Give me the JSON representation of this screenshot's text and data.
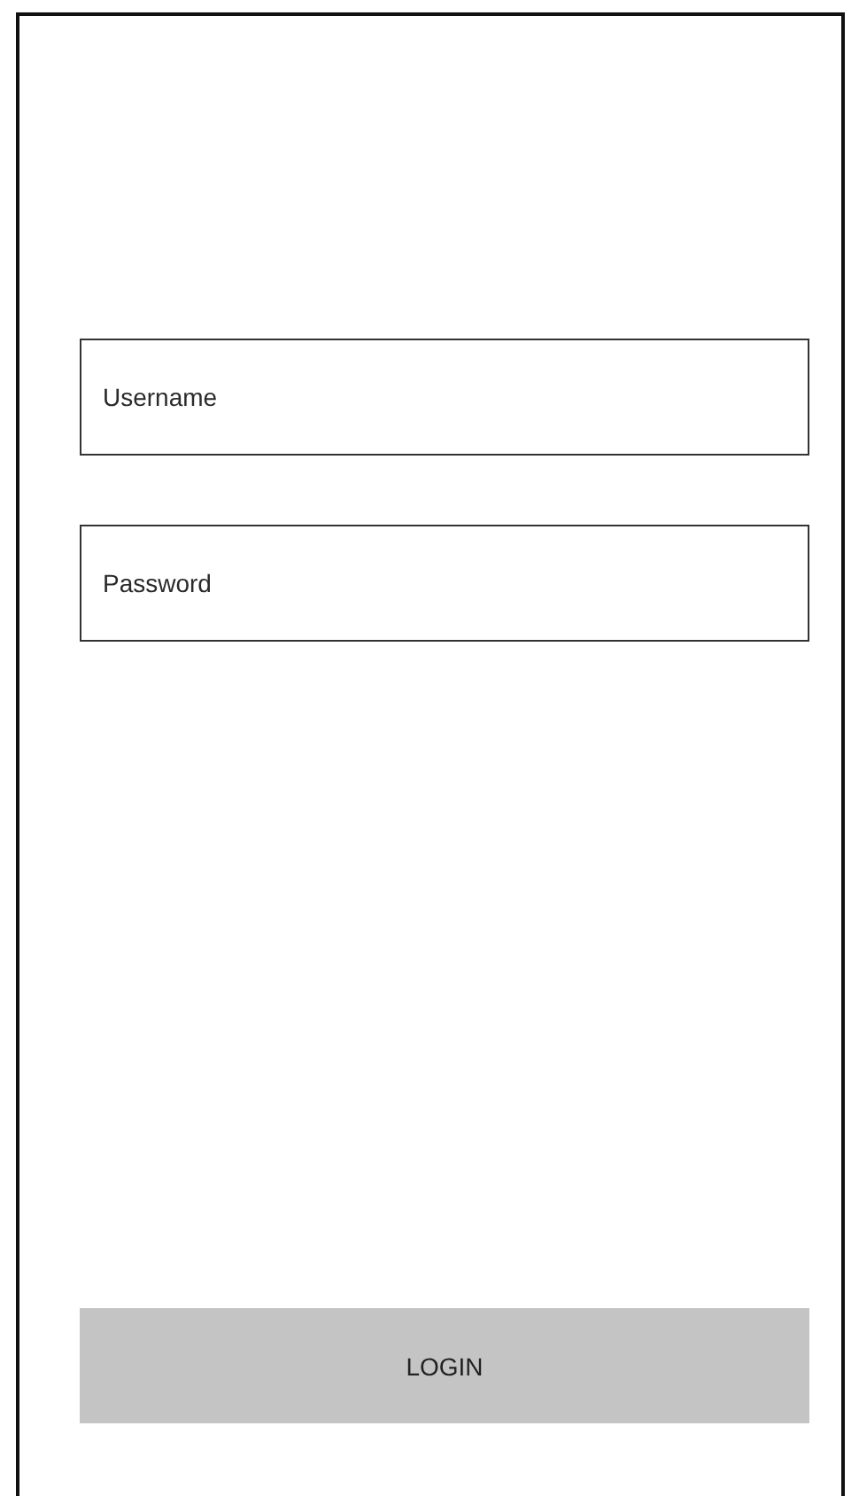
{
  "fields": [
    {
      "placeholder": "Username"
    },
    {
      "placeholder": "Password"
    }
  ],
  "button": {
    "label": "LOGIN"
  }
}
